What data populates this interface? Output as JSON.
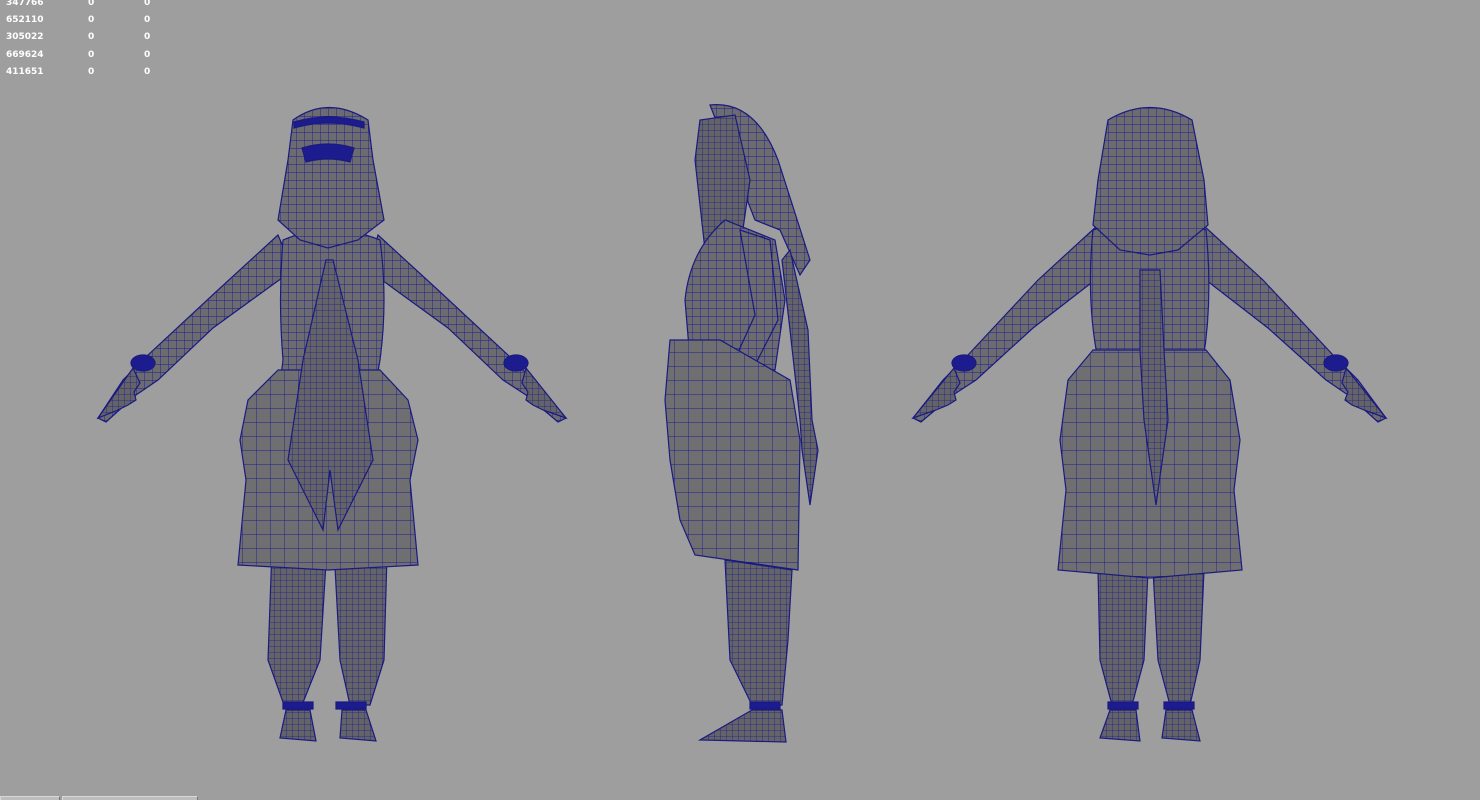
{
  "hud": {
    "rows": [
      {
        "id": "347766",
        "a": "0",
        "b": "0"
      },
      {
        "id": "652110",
        "a": "0",
        "b": "0"
      },
      {
        "id": "305022",
        "a": "0",
        "b": "0"
      },
      {
        "id": "669624",
        "a": "0",
        "b": "0"
      },
      {
        "id": "411651",
        "a": "0",
        "b": "0"
      }
    ]
  },
  "colors": {
    "background": "#9e9e9e",
    "mesh_fill": "#6e6e6e",
    "wireframe": "#1a1a8c"
  },
  "views": {
    "front": "character-front-view",
    "side": "character-side-view",
    "back": "character-back-view"
  }
}
